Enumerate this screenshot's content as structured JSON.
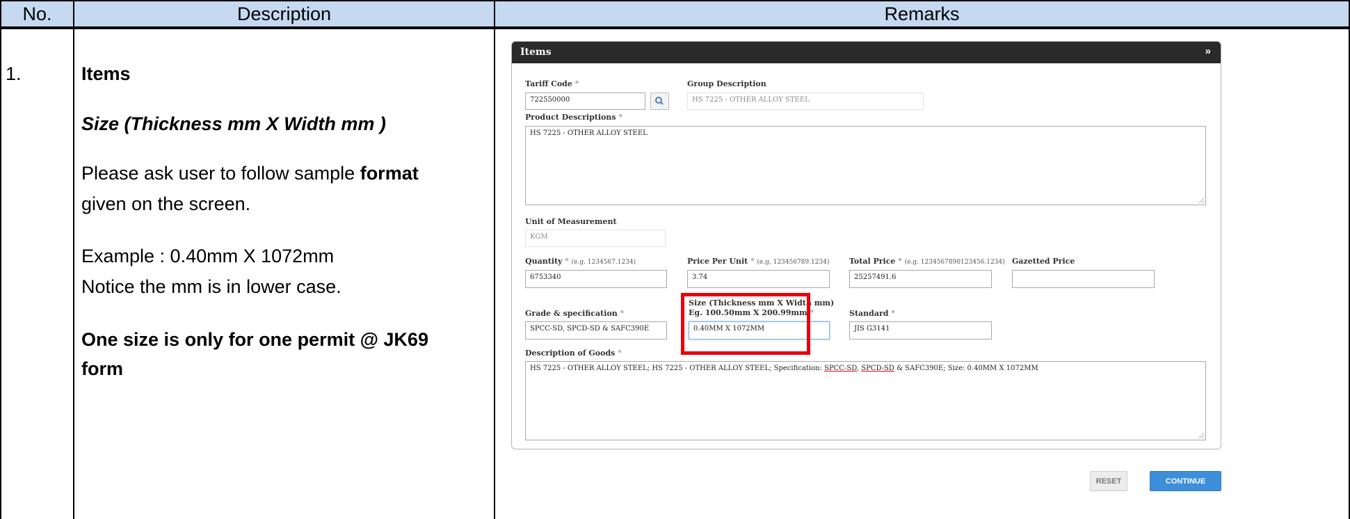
{
  "table": {
    "headers": [
      "No.",
      "Description",
      "Remarks"
    ],
    "row": {
      "number": "1.",
      "title": "Items",
      "subtitle": "Size (Thickness mm X Width mm )",
      "para1_line1_pre": "Please ask user to follow sample ",
      "para1_line1_bold": "format",
      "para1_line2": "given on the screen.",
      "example_line1": "Example : 0.40mm X 1072mm",
      "example_line2": "Notice the mm is in lower case.",
      "note_line1": "One size is only for one permit @ JK69",
      "note_line2": "form"
    }
  },
  "screen": {
    "panel_title": "Items",
    "tariff_code_label": "Tariff Code",
    "tariff_code_value": "722550000",
    "group_description_label": "Group Description",
    "group_description_value": "HS 7225 - OTHER ALLOY STEEL",
    "product_descriptions_label": "Product Descriptions",
    "product_descriptions_value": "HS 7225 - OTHER ALLOY STEEL",
    "uom_label": "Unit of Measurement",
    "uom_value": "KGM",
    "quantity_label": "Quantity",
    "quantity_hint": "(e.g. 1234567.1234)",
    "quantity_value": "6753340",
    "price_per_unit_label": "Price Per Unit",
    "price_per_unit_hint": "(e.g. 123456789.1234)",
    "price_per_unit_value": "3.74",
    "total_price_label": "Total Price",
    "total_price_hint": "(e.g. 1234567890123456.1234)",
    "total_price_value": "25257491.6",
    "gazetted_price_label": "Gazetted Price",
    "gazetted_price_value": "",
    "grade_label": "Grade & specification",
    "grade_value": "SPCC-SD, SPCD-SD & SAFC390E",
    "size_label_line1": "Size (Thickness mm X Width mm)",
    "size_label_line2": "Eg. 100.50mm X 200.99mm",
    "size_value": "0.40MM X 1072MM",
    "standard_label": "Standard",
    "standard_value": "JIS G3141",
    "description_of_goods_label": "Description of Goods",
    "dog_part1": "HS 7225 - OTHER ALLOY STEEL; HS 7225 - OTHER ALLOY STEEL; Specification: ",
    "dog_ul1": "SPCC-SD",
    "dog_sep": ", ",
    "dog_ul2": "SPCD-SD",
    "dog_part2": " & SAFC390E; Size: 0.40MM X 1072MM",
    "required_mark": "*",
    "reset_label": "RESET",
    "continue_label": "CONTINUE"
  },
  "icons": {
    "collapse": "double-chevron-down-icon",
    "search": "magnifier-icon"
  },
  "colors": {
    "header_bg": "#c5d9f1",
    "panel_header": "#2a2a2a",
    "highlight_box": "#e8000d",
    "continue_button": "#3d8fd9"
  }
}
